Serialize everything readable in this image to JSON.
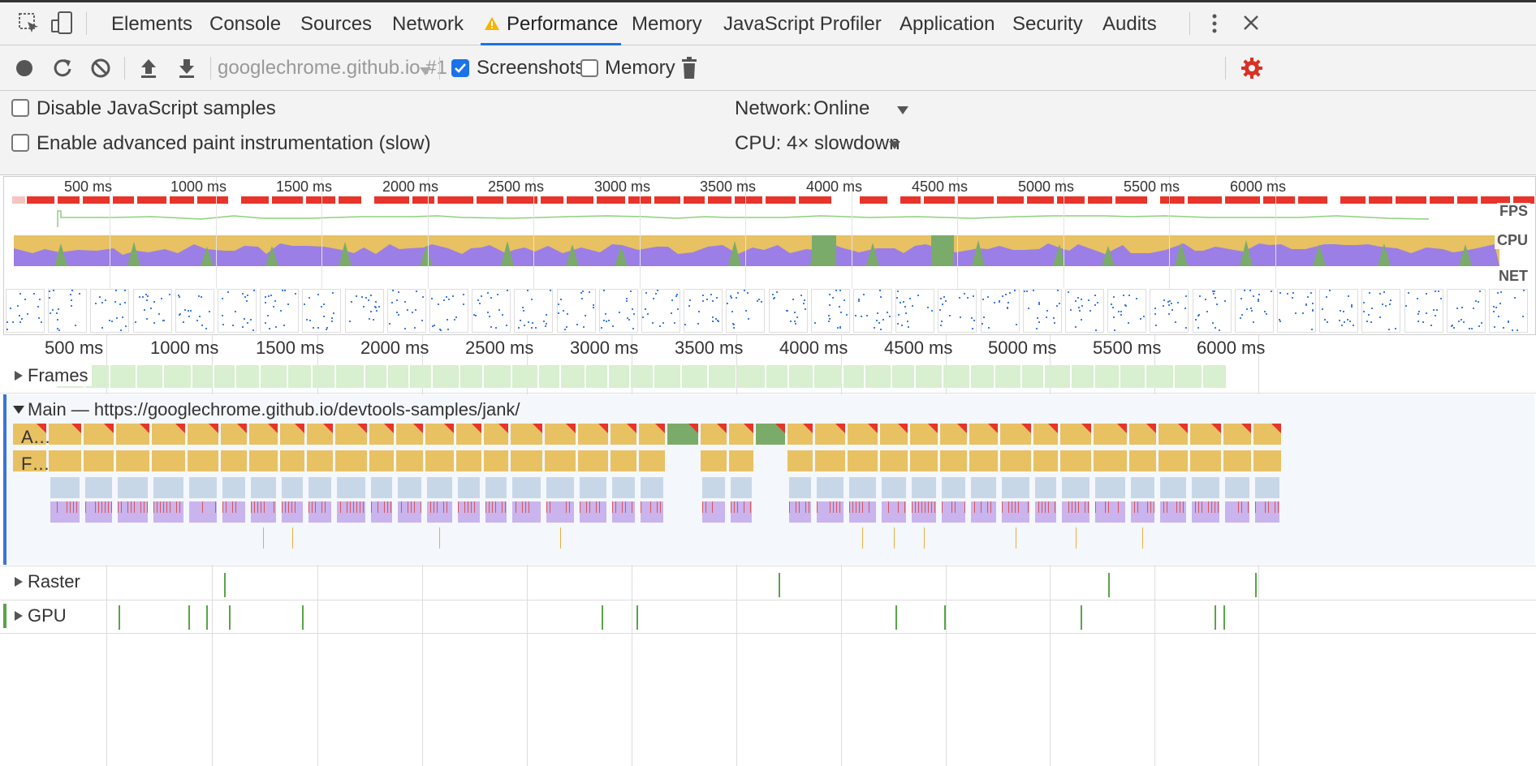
{
  "tabs": [
    {
      "label": "Elements",
      "active": false
    },
    {
      "label": "Console",
      "active": false
    },
    {
      "label": "Sources",
      "active": false
    },
    {
      "label": "Network",
      "active": false
    },
    {
      "label": "Performance",
      "active": true
    },
    {
      "label": "Memory",
      "active": false
    },
    {
      "label": "JavaScript Profiler",
      "active": false
    },
    {
      "label": "Application",
      "active": false
    },
    {
      "label": "Security",
      "active": false
    },
    {
      "label": "Audits",
      "active": false
    }
  ],
  "toolbar": {
    "profile_select": "googlechrome.github.io #1",
    "screenshots_label": "Screenshots",
    "screenshots_checked": true,
    "memory_label": "Memory",
    "memory_checked": false
  },
  "settings": {
    "disable_js_samples": "Disable JavaScript samples",
    "enable_paint": "Enable advanced paint instrumentation (slow)",
    "network_label": "Network:",
    "network_value": "Online",
    "cpu_label": "CPU:",
    "cpu_value": "4× slowdown"
  },
  "overview": {
    "ticks": [
      "500 ms",
      "1000 ms",
      "1500 ms",
      "2000 ms",
      "2500 ms",
      "3000 ms",
      "3500 ms",
      "4000 ms",
      "4500 ms",
      "5000 ms",
      "5500 ms",
      "6000 ms"
    ],
    "fps_label": "FPS",
    "cpu_label": "CPU",
    "net_label": "NET"
  },
  "ruler": {
    "ticks": [
      "500 ms",
      "1000 ms",
      "1500 ms",
      "2000 ms",
      "2500 ms",
      "3000 ms",
      "3500 ms",
      "4000 ms",
      "4500 ms",
      "5000 ms",
      "5500 ms",
      "6000 ms"
    ]
  },
  "tracks": {
    "frames": "Frames",
    "main": "Main — https://googlechrome.github.io/devtools-samples/jank/",
    "main_row1": "A…",
    "main_row2": "F…",
    "raster": "Raster",
    "gpu": "GPU"
  },
  "colors": {
    "accent": "#1a73e8",
    "fps_red": "#e8342a",
    "cpu_yellow": "#e8c162",
    "cpu_purple": "#9b7fe6",
    "cpu_green": "#7aab6a",
    "frames_green": "#d8efd0",
    "task_yellow": "#e8c162",
    "task_blue": "#c8d7e8",
    "gpu_green": "#5aa348",
    "settings_red": "#d93025"
  },
  "icons": [
    "inspect-icon",
    "device-icon",
    "more-icon",
    "close-icon",
    "record-icon",
    "reload-icon",
    "clear-icon",
    "upload-icon",
    "download-icon",
    "dropdown-icon",
    "trash-icon",
    "gear-icon"
  ]
}
